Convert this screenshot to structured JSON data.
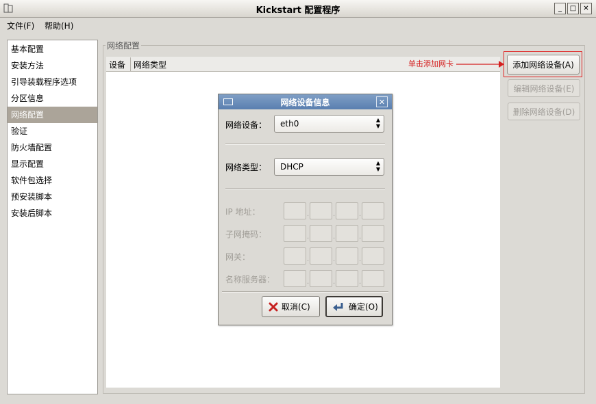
{
  "window": {
    "title": "Kickstart 配置程序",
    "controls": {
      "minimize": "_",
      "maximize": "□",
      "close": "✕"
    }
  },
  "menubar": {
    "file": "文件(F)",
    "help": "帮助(H)"
  },
  "sidebar": {
    "items": [
      {
        "label": "基本配置"
      },
      {
        "label": "安装方法"
      },
      {
        "label": "引导装载程序选项"
      },
      {
        "label": "分区信息"
      },
      {
        "label": "网络配置",
        "selected": true
      },
      {
        "label": "验证"
      },
      {
        "label": "防火墙配置"
      },
      {
        "label": "显示配置"
      },
      {
        "label": "软件包选择"
      },
      {
        "label": "预安装脚本"
      },
      {
        "label": "安装后脚本"
      }
    ]
  },
  "network": {
    "section_title": "网络配置",
    "columns": [
      "设备",
      "网络类型"
    ],
    "buttons": {
      "add": "添加网络设备(A)",
      "edit": "编辑网络设备(E)",
      "delete": "删除网络设备(D)"
    },
    "hint": "单击添加网卡"
  },
  "dialog": {
    "title": "网络设备信息",
    "device_label": "网络设备：",
    "device_value": "eth0",
    "type_label": "网络类型：",
    "type_value": "DHCP",
    "ip_label": "IP 地址：",
    "netmask_label": "子网掩码：",
    "gateway_label": "网关：",
    "nameserver_label": "名称服务器：",
    "cancel": "取消(C)",
    "ok": "确定(O)"
  },
  "colors": {
    "accent_red": "#d41f1f",
    "dialog_title": "#5a7fb0",
    "selected_row": "#aba499"
  }
}
